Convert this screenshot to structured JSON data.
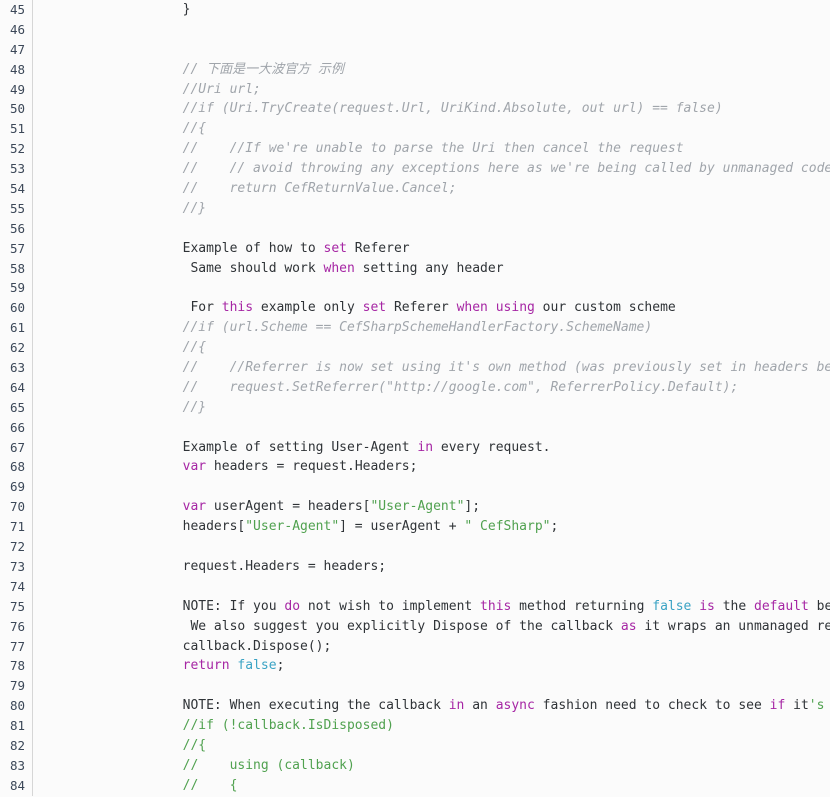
{
  "editor": {
    "name": "code-editor",
    "language": "csharp",
    "first_line_number": 45,
    "last_line_number": 84,
    "background_color": "#fbfbfb",
    "gutter_color": "#fbfbfb",
    "gutter_divider_color": "#d6d6d6",
    "line_number_color": "#3c4858",
    "colors": {
      "plain": "#2f3337",
      "comment": "#a0a5ab",
      "keyword": "#a626a4",
      "string": "#50a14f",
      "literal": "#3aa3c4"
    }
  },
  "lines": [
    {
      "number": "45",
      "tokens": [
        {
          "t": "plain",
          "s": "        }"
        }
      ]
    },
    {
      "number": "46",
      "tokens": [
        {
          "t": "plain",
          "s": ""
        }
      ]
    },
    {
      "number": "47",
      "tokens": [
        {
          "t": "plain",
          "s": ""
        }
      ]
    },
    {
      "number": "48",
      "tokens": [
        {
          "t": "comment",
          "s": "        // 下面是一大波官方 示例"
        }
      ]
    },
    {
      "number": "49",
      "tokens": [
        {
          "t": "comment",
          "s": "        //Uri url;"
        }
      ]
    },
    {
      "number": "50",
      "tokens": [
        {
          "t": "comment",
          "s": "        //if (Uri.TryCreate(request.Url, UriKind.Absolute, out url) == false)"
        }
      ]
    },
    {
      "number": "51",
      "tokens": [
        {
          "t": "comment",
          "s": "        //{"
        }
      ]
    },
    {
      "number": "52",
      "tokens": [
        {
          "t": "comment",
          "s": "        //    //If we're unable to parse the Uri then cancel the request"
        }
      ]
    },
    {
      "number": "53",
      "tokens": [
        {
          "t": "comment",
          "s": "        //    // avoid throwing any exceptions here as we're being called by unmanaged code"
        }
      ]
    },
    {
      "number": "54",
      "tokens": [
        {
          "t": "comment",
          "s": "        //    return CefReturnValue.Cancel;"
        }
      ]
    },
    {
      "number": "55",
      "tokens": [
        {
          "t": "comment",
          "s": "        //}"
        }
      ]
    },
    {
      "number": "56",
      "tokens": [
        {
          "t": "plain",
          "s": ""
        }
      ]
    },
    {
      "number": "57",
      "tokens": [
        {
          "t": "plain",
          "s": "        Example of how to "
        },
        {
          "t": "keyword",
          "s": "set"
        },
        {
          "t": "plain",
          "s": " Referer"
        }
      ]
    },
    {
      "number": "58",
      "tokens": [
        {
          "t": "plain",
          "s": "         Same should work "
        },
        {
          "t": "keyword",
          "s": "when"
        },
        {
          "t": "plain",
          "s": " setting any header"
        }
      ]
    },
    {
      "number": "59",
      "tokens": [
        {
          "t": "plain",
          "s": ""
        }
      ]
    },
    {
      "number": "60",
      "tokens": [
        {
          "t": "plain",
          "s": "         For "
        },
        {
          "t": "keyword",
          "s": "this"
        },
        {
          "t": "plain",
          "s": " example only "
        },
        {
          "t": "keyword",
          "s": "set"
        },
        {
          "t": "plain",
          "s": " Referer "
        },
        {
          "t": "keyword",
          "s": "when"
        },
        {
          "t": "plain",
          "s": " "
        },
        {
          "t": "keyword",
          "s": "using"
        },
        {
          "t": "plain",
          "s": " our custom scheme"
        }
      ]
    },
    {
      "number": "61",
      "tokens": [
        {
          "t": "comment",
          "s": "        //if (url.Scheme == CefSharpSchemeHandlerFactory.SchemeName)"
        }
      ]
    },
    {
      "number": "62",
      "tokens": [
        {
          "t": "comment",
          "s": "        //{"
        }
      ]
    },
    {
      "number": "63",
      "tokens": [
        {
          "t": "comment",
          "s": "        //    //Referrer is now set using it's own method (was previously set in headers before)"
        }
      ]
    },
    {
      "number": "64",
      "tokens": [
        {
          "t": "comment",
          "s": "        //    request.SetReferrer(\"http://google.com\", ReferrerPolicy.Default);"
        }
      ]
    },
    {
      "number": "65",
      "tokens": [
        {
          "t": "comment",
          "s": "        //}"
        }
      ]
    },
    {
      "number": "66",
      "tokens": [
        {
          "t": "plain",
          "s": ""
        }
      ]
    },
    {
      "number": "67",
      "tokens": [
        {
          "t": "plain",
          "s": "        Example of setting User-Agent "
        },
        {
          "t": "keyword",
          "s": "in"
        },
        {
          "t": "plain",
          "s": " every request."
        }
      ]
    },
    {
      "number": "68",
      "tokens": [
        {
          "t": "plain",
          "s": "        "
        },
        {
          "t": "keyword",
          "s": "var"
        },
        {
          "t": "plain",
          "s": " headers = request.Headers;"
        }
      ]
    },
    {
      "number": "69",
      "tokens": [
        {
          "t": "plain",
          "s": ""
        }
      ]
    },
    {
      "number": "70",
      "tokens": [
        {
          "t": "plain",
          "s": "        "
        },
        {
          "t": "keyword",
          "s": "var"
        },
        {
          "t": "plain",
          "s": " userAgent = headers["
        },
        {
          "t": "string",
          "s": "\"User-Agent\""
        },
        {
          "t": "plain",
          "s": "];"
        }
      ]
    },
    {
      "number": "71",
      "tokens": [
        {
          "t": "plain",
          "s": "        headers["
        },
        {
          "t": "string",
          "s": "\"User-Agent\""
        },
        {
          "t": "plain",
          "s": "] = userAgent + "
        },
        {
          "t": "string",
          "s": "\" CefSharp\""
        },
        {
          "t": "plain",
          "s": ";"
        }
      ]
    },
    {
      "number": "72",
      "tokens": [
        {
          "t": "plain",
          "s": ""
        }
      ]
    },
    {
      "number": "73",
      "tokens": [
        {
          "t": "plain",
          "s": "        request.Headers = headers;"
        }
      ]
    },
    {
      "number": "74",
      "tokens": [
        {
          "t": "plain",
          "s": ""
        }
      ]
    },
    {
      "number": "75",
      "tokens": [
        {
          "t": "plain",
          "s": "        NOTE: If you "
        },
        {
          "t": "keyword",
          "s": "do"
        },
        {
          "t": "plain",
          "s": " not wish to implement "
        },
        {
          "t": "keyword",
          "s": "this"
        },
        {
          "t": "plain",
          "s": " method returning "
        },
        {
          "t": "literal",
          "s": "false"
        },
        {
          "t": "plain",
          "s": " "
        },
        {
          "t": "keyword",
          "s": "is"
        },
        {
          "t": "plain",
          "s": " the "
        },
        {
          "t": "keyword",
          "s": "default"
        },
        {
          "t": "plain",
          "s": " behaviour"
        }
      ]
    },
    {
      "number": "76",
      "tokens": [
        {
          "t": "plain",
          "s": "         We also suggest you explicitly Dispose of the callback "
        },
        {
          "t": "keyword",
          "s": "as"
        },
        {
          "t": "plain",
          "s": " it wraps an unmanaged resource."
        }
      ]
    },
    {
      "number": "77",
      "tokens": [
        {
          "t": "plain",
          "s": "        callback.Dispose();"
        }
      ]
    },
    {
      "number": "78",
      "tokens": [
        {
          "t": "plain",
          "s": "        "
        },
        {
          "t": "keyword",
          "s": "return"
        },
        {
          "t": "plain",
          "s": " "
        },
        {
          "t": "literal",
          "s": "false"
        },
        {
          "t": "plain",
          "s": ";"
        }
      ]
    },
    {
      "number": "79",
      "tokens": [
        {
          "t": "plain",
          "s": ""
        }
      ]
    },
    {
      "number": "80",
      "tokens": [
        {
          "t": "plain",
          "s": "        NOTE: When executing the callback "
        },
        {
          "t": "keyword",
          "s": "in"
        },
        {
          "t": "plain",
          "s": " an "
        },
        {
          "t": "keyword",
          "s": "async"
        },
        {
          "t": "plain",
          "s": " fashion need to check to see "
        },
        {
          "t": "keyword",
          "s": "if"
        },
        {
          "t": "plain",
          "s": " it"
        },
        {
          "t": "string",
          "s": "'s disposed"
        }
      ]
    },
    {
      "number": "81",
      "tokens": [
        {
          "t": "string",
          "s": "        //if (!callback.IsDisposed)"
        }
      ]
    },
    {
      "number": "82",
      "tokens": [
        {
          "t": "string",
          "s": "        //{"
        }
      ]
    },
    {
      "number": "83",
      "tokens": [
        {
          "t": "string",
          "s": "        //    using (callback)"
        }
      ]
    },
    {
      "number": "84",
      "tokens": [
        {
          "t": "string",
          "s": "        //    {"
        }
      ]
    }
  ]
}
